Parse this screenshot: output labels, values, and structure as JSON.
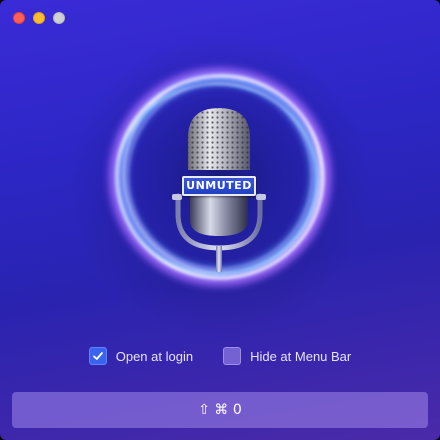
{
  "window": {
    "controls": [
      "close",
      "minimize",
      "zoom"
    ]
  },
  "microphone": {
    "status_badge": "UNMUTED",
    "icon": "microphone-icon"
  },
  "options": {
    "open_at_login": {
      "label": "Open at login",
      "checked": true
    },
    "hide_at_menu_bar": {
      "label": "Hide at Menu Bar",
      "checked": false
    }
  },
  "shortcut": {
    "keys": "⇧ ⌘ 0"
  },
  "colors": {
    "accent": "#3a63f0",
    "background": "#2c26c4",
    "close": "#fe5f57",
    "minimize": "#febc2e"
  }
}
